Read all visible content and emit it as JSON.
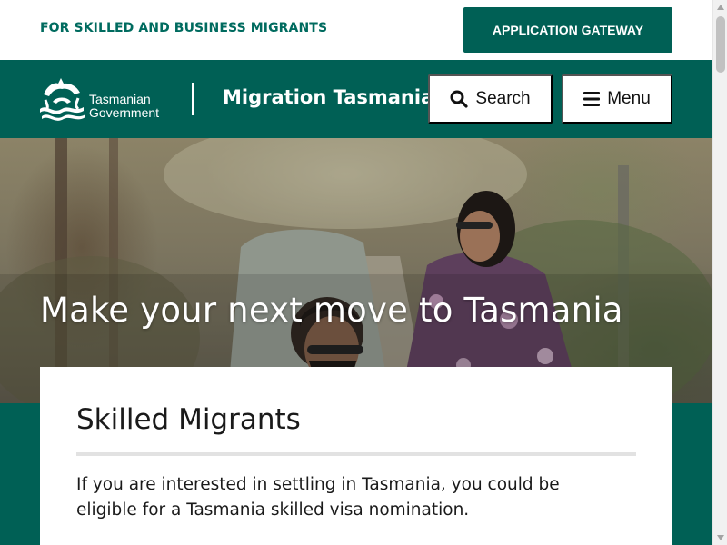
{
  "utility_bar": {
    "audience_link": "FOR SKILLED AND BUSINESS MIGRANTS",
    "gateway_button": "APPLICATION GATEWAY"
  },
  "header": {
    "logo_line1": "Tasmanian",
    "logo_line2": "Government",
    "logo_icon": "tasmanian-devil-logo",
    "site_title": "Migration Tasmania",
    "search_label": "Search",
    "search_icon": "search-icon",
    "menu_label": "Menu",
    "menu_icon": "hamburger-icon"
  },
  "hero": {
    "heading": "Make your next move to Tasmania"
  },
  "intro_card": {
    "title": "Skilled Migrants",
    "text": "If you are interested in settling in Tasmania, you could be eligible for a Tasmania skilled visa nomination."
  },
  "colors": {
    "brand_teal": "#006055",
    "link_teal": "#006b5f",
    "white": "#ffffff",
    "text": "#1a1a1a"
  }
}
